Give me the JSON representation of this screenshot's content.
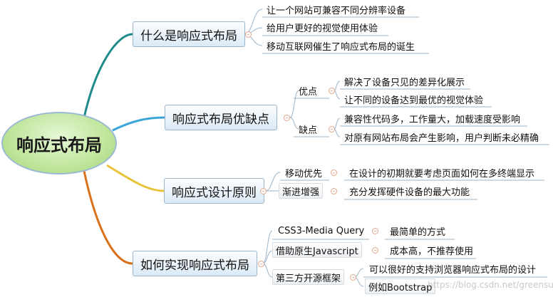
{
  "root": {
    "label": "响应式布局"
  },
  "branches": [
    {
      "label": "什么是响应式布局",
      "children": [
        {
          "label": "让一个网站可兼容不同分辨率设备"
        },
        {
          "label": "给用户更好的视觉使用体验"
        },
        {
          "label": "移动互联网催生了响应式布局的诞生"
        }
      ]
    },
    {
      "label": "响应式布局优缺点",
      "children": [
        {
          "label": "优点",
          "children": [
            {
              "label": "解决了设备只见的差异化展示"
            },
            {
              "label": "让不同的设备达到最优的视觉体验"
            }
          ]
        },
        {
          "label": "缺点",
          "children": [
            {
              "label": "兼容性代码多，工作量大，加载速度受影响"
            },
            {
              "label": "对原有网站布局会产生影响，用户判断未必精确"
            }
          ]
        }
      ]
    },
    {
      "label": "响应式设计原则",
      "children": [
        {
          "label": "移动优先",
          "children": [
            {
              "label": "在设计的初期就要考虑页面如何在多终端显示"
            }
          ]
        },
        {
          "label": "渐进增强",
          "children": [
            {
              "label": "充分发挥硬件设备的最大功能"
            }
          ]
        }
      ]
    },
    {
      "label": "如何实现响应式布局",
      "children": [
        {
          "label": "CSS3-Media Query",
          "children": [
            {
              "label": "最简单的方式"
            }
          ]
        },
        {
          "label": "借助原生Javascript",
          "children": [
            {
              "label": "成本高，不推荐使用"
            }
          ]
        },
        {
          "label": "第三方开源框架",
          "children": [
            {
              "label": "可以很好的支持浏览器响应式布局的设计"
            },
            {
              "label": "例如Bootstrap"
            }
          ]
        }
      ]
    }
  ],
  "watermark": "https://blog.csdn.net/greensure",
  "colors": {
    "branch_lines": [
      "#1e8a8a",
      "#3aa7d8",
      "#e8c43a",
      "#d9701a"
    ],
    "root_fill": "#bfe69b",
    "node_fill": "#dceaf6",
    "collapse_icon": "#d2704a"
  }
}
